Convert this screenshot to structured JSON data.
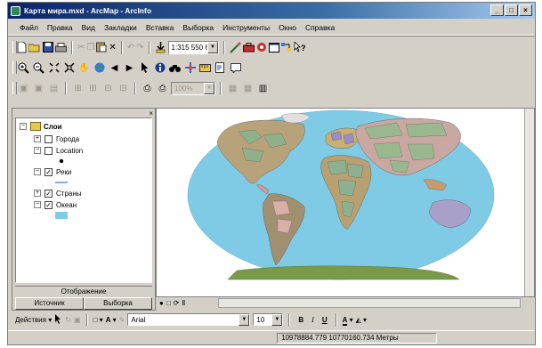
{
  "window": {
    "title": "Карта мира.mxd - ArcMap - ArcInfo"
  },
  "window_buttons": {
    "minimize": "_",
    "maximize": "□",
    "close": "×"
  },
  "menu": [
    "Файл",
    "Правка",
    "Вид",
    "Закладки",
    "Вставка",
    "Выборка",
    "Инструменты",
    "Окно",
    "Справка"
  ],
  "standard_toolbar": {
    "scale_value": "1:315 550 681"
  },
  "editor_toolbar": {
    "scale_value": "100%"
  },
  "toc": {
    "root_label": "Слои",
    "layers": [
      {
        "name": "Города",
        "checked": false,
        "expanded": false
      },
      {
        "name": "Location",
        "checked": false,
        "expanded": true
      },
      {
        "name": "Реки",
        "checked": true,
        "expanded": true
      },
      {
        "name": "Страны",
        "checked": true,
        "expanded": false
      },
      {
        "name": "Океан",
        "checked": true,
        "expanded": true
      }
    ],
    "display_label": "Отображение",
    "tabs": [
      "Источник",
      "Выборка"
    ]
  },
  "drawing_toolbar": {
    "drawing_label": "Действия ▾",
    "font_name": "Arial",
    "font_size": "10",
    "bold": "B",
    "italic": "I",
    "underline": "U"
  },
  "statusbar": {
    "coordinates": "10978884.779  10770160.734 Метры"
  },
  "colors": {
    "ocean": "#7fcbe5",
    "land_green": "#7a9a4a",
    "titlebar": "#0a246a",
    "chrome": "#d4d0c8"
  }
}
